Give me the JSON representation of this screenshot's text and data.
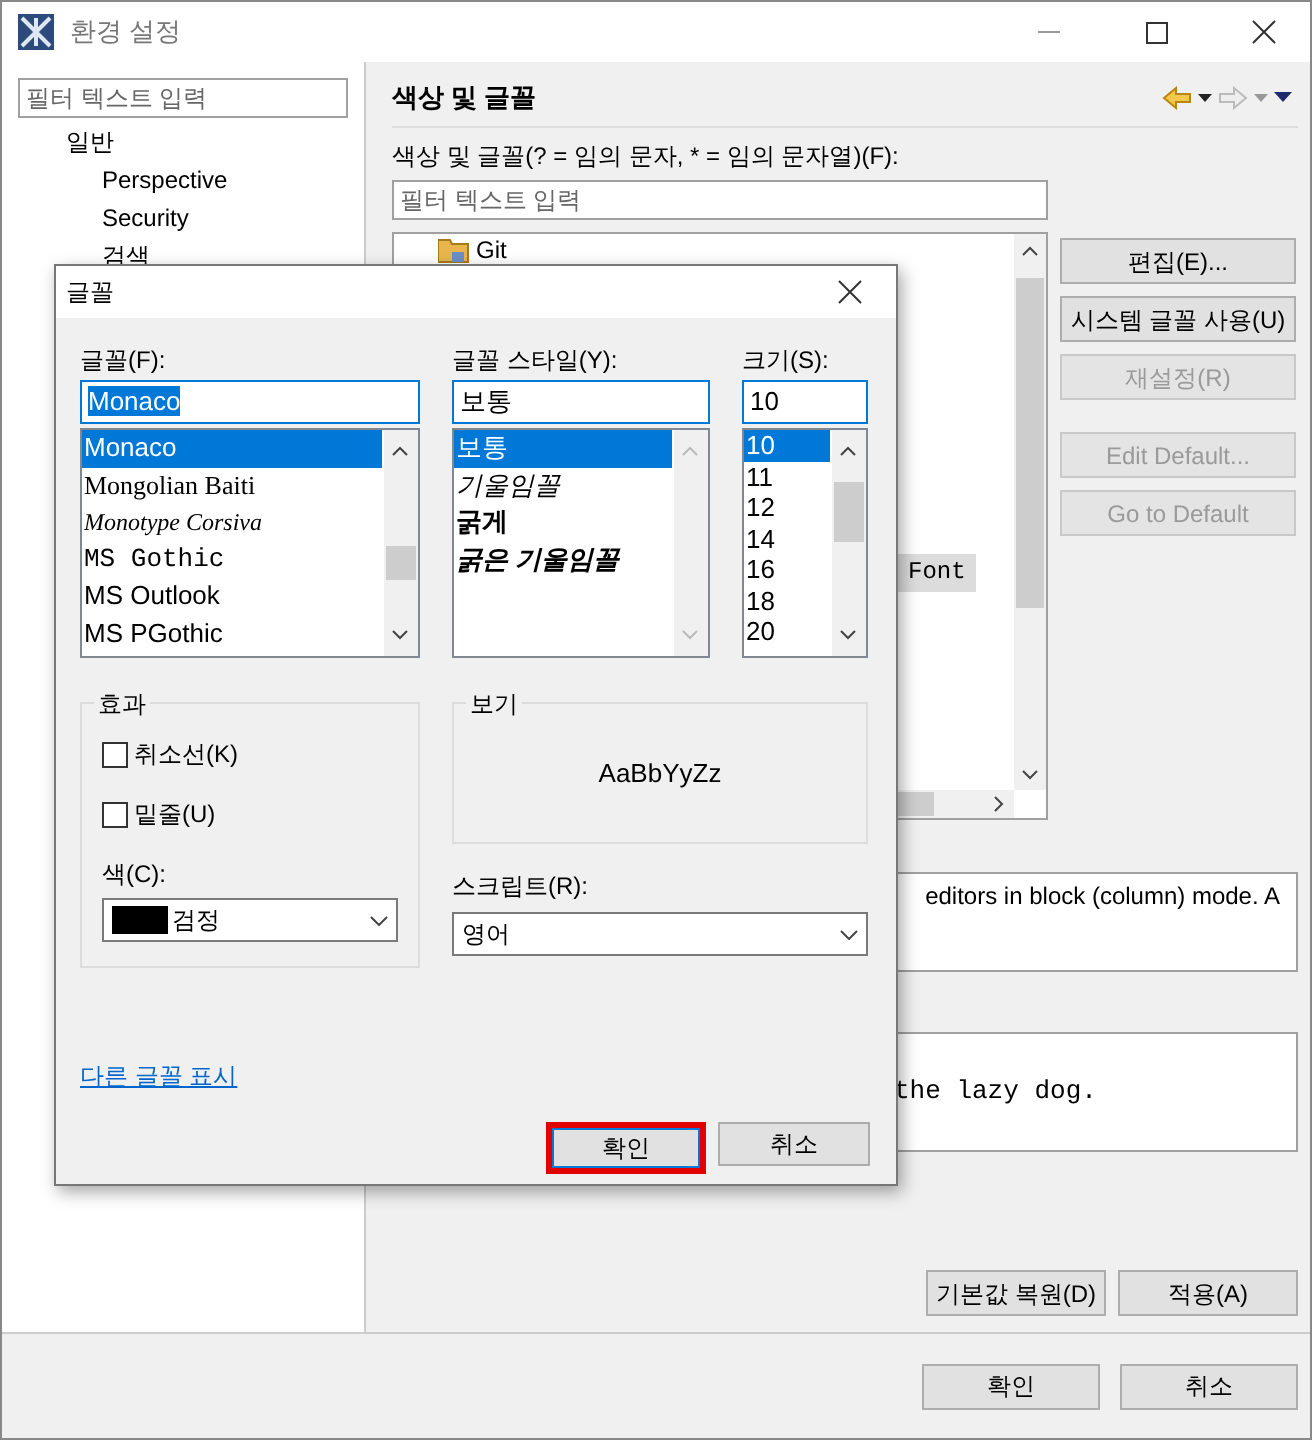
{
  "window": {
    "title": "환경 설정"
  },
  "sidebar": {
    "filter": {
      "placeholder": "필터 텍스트 입력"
    },
    "items": [
      {
        "label": "일반",
        "children": [
          {
            "label": "Perspective"
          },
          {
            "label": "Security"
          },
          {
            "label": "검색"
          }
        ]
      }
    ]
  },
  "page": {
    "title": "색상 및 글꼴",
    "filter_label": "색상 및 글꼴(? = 임의 문자, * = 임의 문자열)(F):",
    "filter": {
      "placeholder": "필터 텍스트 입력"
    },
    "tree": [
      {
        "label": "Git",
        "kind": "folder",
        "selected": false
      },
      {
        "label": "Font",
        "kind": "font",
        "selected": true
      }
    ],
    "buttons": [
      {
        "label": "편집(E)...",
        "disabled": false
      },
      {
        "label": "시스템 글꼴 사용(U)",
        "disabled": false
      },
      {
        "label": "재설정(R)",
        "disabled": true
      },
      {
        "label": "Edit Default...",
        "disabled": true
      },
      {
        "label": "Go to Default",
        "disabled": true
      }
    ],
    "description": "editors in block (column) mode. A",
    "preview": "the lazy dog.",
    "bottom_buttons": [
      "기본값 복원(D)",
      "적용(A)"
    ]
  },
  "footer_buttons": [
    "확인",
    "취소"
  ],
  "font_dialog": {
    "title": "글꼴",
    "font": {
      "label": "글꼴(F):",
      "value": "Monaco",
      "items": [
        {
          "label": "Monaco",
          "kind": "sans",
          "selected": true
        },
        {
          "label": "Mongolian Baiti",
          "kind": "serif",
          "selected": false
        },
        {
          "label": "Monotype Corsiva",
          "kind": "script",
          "selected": false
        },
        {
          "label": "MS Gothic",
          "kind": "mono",
          "selected": false
        },
        {
          "label": "MS Outlook",
          "kind": "sans",
          "selected": false
        },
        {
          "label": "MS PGothic",
          "kind": "sans",
          "selected": false
        }
      ]
    },
    "style": {
      "label": "글꼴 스타일(Y):",
      "value": "보통",
      "items": [
        {
          "label": "보통",
          "kind": "regular",
          "selected": true
        },
        {
          "label": "기울임꼴",
          "kind": "italic",
          "selected": false
        },
        {
          "label": "굵게",
          "kind": "bold",
          "selected": false
        },
        {
          "label": "굵은 기울임꼴",
          "kind": "bold-italic",
          "selected": false
        }
      ]
    },
    "size": {
      "label": "크기(S):",
      "value": "10",
      "items": [
        {
          "label": "10",
          "selected": true
        },
        {
          "label": "11",
          "selected": false
        },
        {
          "label": "12",
          "selected": false
        },
        {
          "label": "14",
          "selected": false
        },
        {
          "label": "16",
          "selected": false
        },
        {
          "label": "18",
          "selected": false
        },
        {
          "label": "20",
          "selected": false
        }
      ]
    },
    "effects": {
      "title": "효과",
      "checkboxes": [
        {
          "label": "취소선(K)",
          "checked": false
        },
        {
          "label": "밑줄(U)",
          "checked": false
        }
      ],
      "color_label": "색(C):",
      "color": {
        "value": "검정",
        "color": "#000000"
      }
    },
    "sample": {
      "title": "보기",
      "text": "AaBbYyZz"
    },
    "script": {
      "label": "스크립트(R):",
      "value": "영어"
    },
    "link": "다른 글꼴 표시",
    "buttons": [
      {
        "label": "확인",
        "highlighted": true
      },
      {
        "label": "취소",
        "highlighted": false
      }
    ]
  }
}
